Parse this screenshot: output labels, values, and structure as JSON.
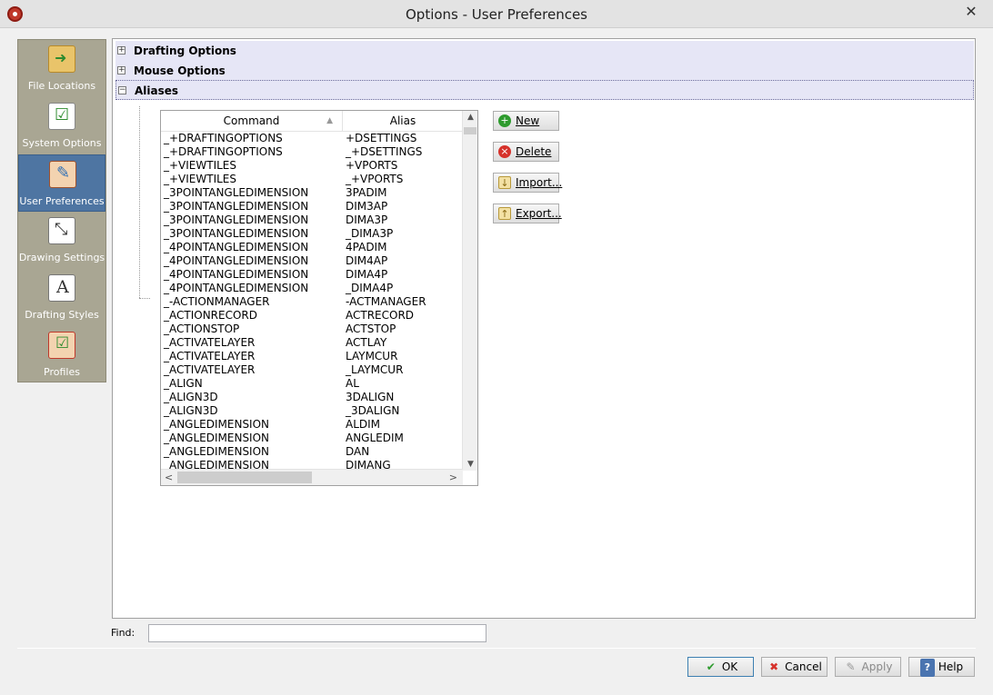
{
  "window": {
    "title": "Options - User Preferences",
    "close": "✕"
  },
  "sidebar": {
    "items": [
      {
        "label": "File Locations",
        "icon": "folder-arrow-icon"
      },
      {
        "label": "System Options",
        "icon": "checklist-icon"
      },
      {
        "label": "User Preferences",
        "icon": "user-pencil-icon",
        "active": true
      },
      {
        "label": "Drawing Settings",
        "icon": "drawing-settings-icon"
      },
      {
        "label": "Drafting Styles",
        "icon": "text-style-icon"
      },
      {
        "label": "Profiles",
        "icon": "user-profile-icon"
      }
    ]
  },
  "tree": {
    "drafting_options": {
      "label": "Drafting Options",
      "toggle": "+"
    },
    "mouse_options": {
      "label": "Mouse Options",
      "toggle": "+"
    },
    "aliases": {
      "label": "Aliases",
      "toggle": "−"
    }
  },
  "alias_table": {
    "headers": {
      "command": "Command",
      "alias": "Alias",
      "sort_indicator": "▲"
    },
    "rows": [
      {
        "command": "_+DRAFTINGOPTIONS",
        "alias": "+DSETTINGS"
      },
      {
        "command": "_+DRAFTINGOPTIONS",
        "alias": "_+DSETTINGS"
      },
      {
        "command": "_+VIEWTILES",
        "alias": "+VPORTS"
      },
      {
        "command": "_+VIEWTILES",
        "alias": "_+VPORTS"
      },
      {
        "command": "_3POINTANGLEDIMENSION",
        "alias": "3PADIM"
      },
      {
        "command": "_3POINTANGLEDIMENSION",
        "alias": "DIM3AP"
      },
      {
        "command": "_3POINTANGLEDIMENSION",
        "alias": "DIMA3P"
      },
      {
        "command": "_3POINTANGLEDIMENSION",
        "alias": "_DIMA3P"
      },
      {
        "command": "_4POINTANGLEDIMENSION",
        "alias": "4PADIM"
      },
      {
        "command": "_4POINTANGLEDIMENSION",
        "alias": "DIM4AP"
      },
      {
        "command": "_4POINTANGLEDIMENSION",
        "alias": "DIMA4P"
      },
      {
        "command": "_4POINTANGLEDIMENSION",
        "alias": "_DIMA4P"
      },
      {
        "command": "_-ACTIONMANAGER",
        "alias": "-ACTMANAGER"
      },
      {
        "command": "_ACTIONRECORD",
        "alias": "ACTRECORD"
      },
      {
        "command": "_ACTIONSTOP",
        "alias": "ACTSTOP"
      },
      {
        "command": "_ACTIVATELAYER",
        "alias": "ACTLAY"
      },
      {
        "command": "_ACTIVATELAYER",
        "alias": "LAYMCUR"
      },
      {
        "command": "_ACTIVATELAYER",
        "alias": "_LAYMCUR"
      },
      {
        "command": "_ALIGN",
        "alias": "AL"
      },
      {
        "command": "_ALIGN3D",
        "alias": "3DALIGN"
      },
      {
        "command": "_ALIGN3D",
        "alias": "_3DALIGN"
      },
      {
        "command": "_ANGLEDIMENSION",
        "alias": "ALDIM"
      },
      {
        "command": "_ANGLEDIMENSION",
        "alias": "ANGLEDIM"
      },
      {
        "command": "_ANGLEDIMENSION",
        "alias": "DAN"
      },
      {
        "command": "_ANGLEDIMENSION",
        "alias": "DIMANG"
      }
    ],
    "scroll": {
      "up": "▲",
      "down": "▼",
      "left": "<",
      "right": ">"
    }
  },
  "actions": {
    "new": {
      "label": "New",
      "icon": "+"
    },
    "delete": {
      "label": "Delete",
      "icon": "×"
    },
    "import": {
      "label": "Import...",
      "icon": "↓"
    },
    "export": {
      "label": "Export...",
      "icon": "↑"
    }
  },
  "find": {
    "label": "Find:",
    "value": "",
    "placeholder": ""
  },
  "buttons": {
    "ok": {
      "label": "OK",
      "icon": "✔"
    },
    "cancel": {
      "label": "Cancel",
      "icon": "✖"
    },
    "apply": {
      "label": "Apply",
      "icon": "✎"
    },
    "help": {
      "label": "Help",
      "icon": "?"
    }
  }
}
